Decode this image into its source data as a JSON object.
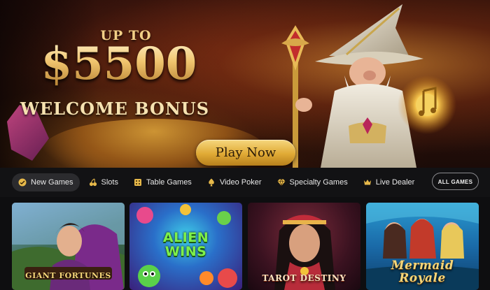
{
  "hero": {
    "bonus_prefix": "UP TO",
    "bonus_amount": "$5500",
    "bonus_label": "WELCOME BONUS",
    "cta_label": "Play Now"
  },
  "nav": {
    "items": [
      {
        "label": "New Games",
        "icon": "new-games-icon",
        "active": true
      },
      {
        "label": "Slots",
        "icon": "cherries-icon"
      },
      {
        "label": "Table Games",
        "icon": "table-games-icon"
      },
      {
        "label": "Video Poker",
        "icon": "spade-icon"
      },
      {
        "label": "Specialty Games",
        "icon": "diamond-icon"
      },
      {
        "label": "Live Dealer",
        "icon": "live-dealer-icon"
      }
    ],
    "all_games_label": "ALL GAMES"
  },
  "games": [
    {
      "title": "GIANT FORTUNES"
    },
    {
      "title": "ALIEN WINS"
    },
    {
      "title": "TAROT DESTINY"
    },
    {
      "title": "Mermaid Royale"
    }
  ],
  "colors": {
    "accent_gold": "#e0aa35",
    "nav_bg": "#121214",
    "active_pill": "#2b2b2e"
  }
}
